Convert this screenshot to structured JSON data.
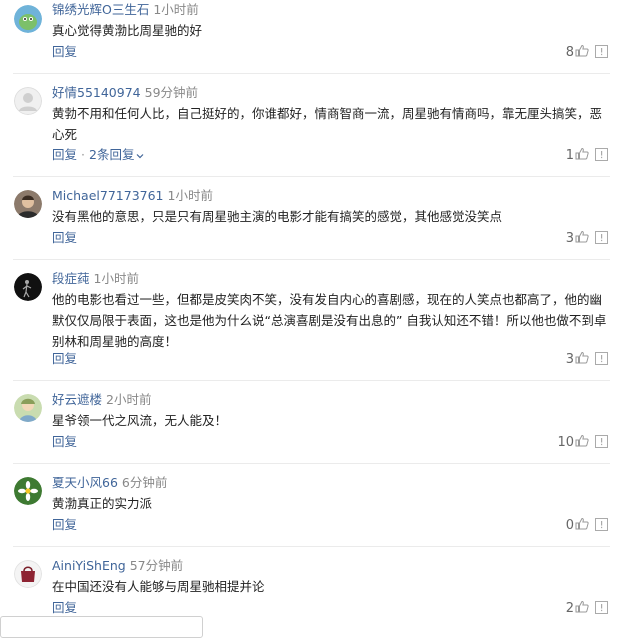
{
  "comments": [
    {
      "username": "锦绣光辉O三生石",
      "time": "1小时前",
      "text": "真心觉得黄渤比周星驰的好",
      "reply_label": "回复",
      "likes": "8",
      "avatar": "green-monster-avatar"
    },
    {
      "username": "好情55140974",
      "time": "59分钟前",
      "text": "黄勃不用和任何人比，自己挺好的，你谁都好，情商智商一流，周星驰有情商吗，靠无厘头搞笑，恶心死",
      "reply_label": "回复",
      "replies_label": "2条回复",
      "likes": "1",
      "avatar": "default-gray-avatar"
    },
    {
      "username": "Michael77173761",
      "time": "1小时前",
      "text": "没有黑他的意思，只是只有周星驰主演的电影才能有搞笑的感觉，其他感觉没笑点",
      "reply_label": "回复",
      "likes": "3",
      "avatar": "man-photo-avatar"
    },
    {
      "username": "段症莼",
      "time": "1小时前",
      "text": "他的电影也看过一些，但都是皮笑肉不笑，没有发自内心的喜剧感，现在的人笑点也都高了，他的幽默仅仅局限于表面，这也是他为什么说“总演喜剧是没有出息的” 自我认知还不错！所以他也做不到卓别林和周星驰的高度！",
      "reply_label": "回复",
      "likes": "3",
      "avatar": "black-figure-avatar"
    },
    {
      "username": "好云遮楼",
      "time": "2小时前",
      "text": "星爷领一代之风流，无人能及！",
      "reply_label": "回复",
      "likes": "10",
      "avatar": "cartoon-avatar"
    },
    {
      "username": "夏天小风66",
      "time": "6分钟前",
      "text": "黄渤真正的实力派",
      "reply_label": "回复",
      "likes": "0",
      "avatar": "flower-avatar"
    },
    {
      "username": "AiniYiShEng",
      "time": "57分钟前",
      "text": "在中国还没有人能够与周星驰相提并论",
      "reply_label": "回复",
      "likes": "2",
      "avatar": "handbag-avatar"
    }
  ],
  "icons": {
    "like": "thumbs-up-icon",
    "report": "report-icon",
    "expand": "chevron-down-icon"
  },
  "colors": {
    "link": "#406599",
    "meta": "#888888",
    "divider": "#ebebeb"
  }
}
